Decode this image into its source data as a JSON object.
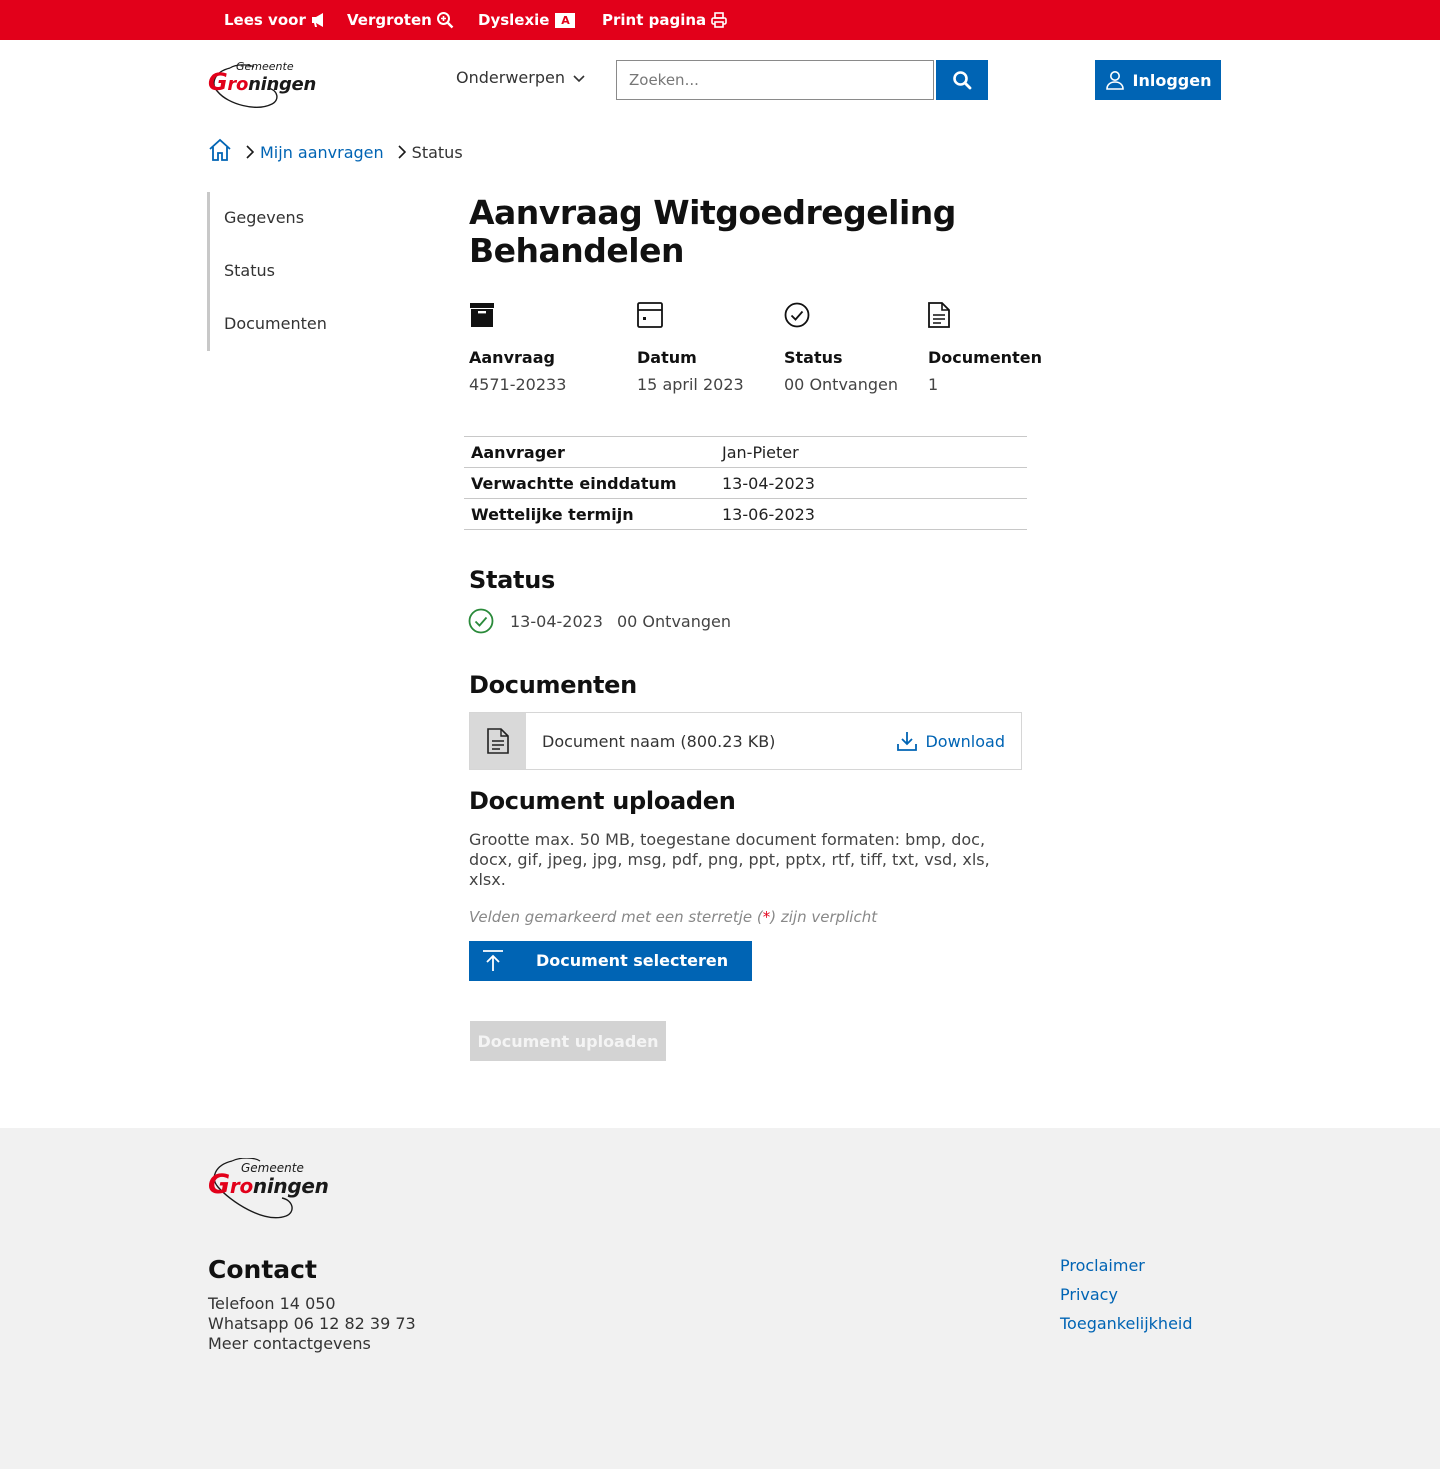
{
  "topbar": {
    "read_aloud": "Lees voor",
    "enlarge": "Vergroten",
    "dyslexia": "Dyslexie",
    "dyslexia_badge": "A",
    "print": "Print pagina"
  },
  "logo": {
    "line1": "Gemeente",
    "line2_g": "G",
    "line2_r": "ro",
    "line2_rest": "ningen"
  },
  "header": {
    "topics": "Onderwerpen",
    "search_placeholder": "Zoeken...",
    "login": "Inloggen"
  },
  "breadcrumb": {
    "home": "Home",
    "link": "Mijn aanvragen",
    "current": "Status"
  },
  "sidenav": [
    "Gegevens",
    "Status",
    "Documenten"
  ],
  "main": {
    "title": "Aanvraag Witgoedregeling Behandelen",
    "summary": [
      {
        "label": "Aanvraag",
        "value": "4571-20233",
        "icon": "archive-icon"
      },
      {
        "label": "Datum",
        "value": "15 april 2023",
        "icon": "calendar-icon"
      },
      {
        "label": "Status",
        "value": "00 Ontvangen",
        "icon": "check-circle-icon"
      },
      {
        "label": "Documenten",
        "value": "1",
        "icon": "document-icon"
      }
    ],
    "details": [
      {
        "key": "Aanvrager",
        "value": "Jan-Pieter"
      },
      {
        "key": "Verwachtte einddatum",
        "value": "13-04-2023"
      },
      {
        "key": "Wettelijke termijn",
        "value": "13-06-2023"
      }
    ],
    "status_heading": "Status",
    "status_entry": {
      "date": "13-04-2023",
      "status": "00 Ontvangen"
    },
    "documents_heading": "Documenten",
    "document": {
      "name": "Document naam (800.23 KB)",
      "download": "Download"
    },
    "upload_heading": "Document uploaden",
    "upload_info": "Grootte max. 50 MB, toegestane document formaten: bmp, doc, docx, gif, jpeg, jpg, msg, pdf, png, ppt, pptx, rtf, tiff, txt, vsd, xls, xlsx.",
    "required_prefix": "Velden gemarkeerd met een sterretje (",
    "required_star": "*",
    "required_suffix": ") zijn verplicht",
    "select_button": "Document selecteren",
    "upload_button": "Document uploaden"
  },
  "footer": {
    "contact_title": "Contact",
    "phone": "Telefoon 14 050",
    "whatsapp": "Whatsapp 06 12 82 39 73",
    "more": "Meer contactgevens",
    "links": [
      "Proclaimer",
      "Privacy",
      "Toegankelijkheid"
    ]
  },
  "colors": {
    "brand_red": "#e2001a",
    "primary_blue": "#0064b4",
    "success_green": "#2a8a3a"
  }
}
